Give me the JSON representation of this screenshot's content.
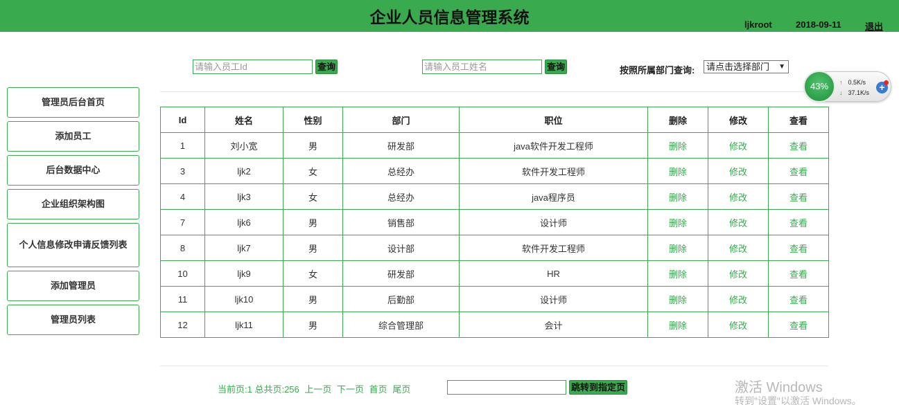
{
  "header": {
    "title": "企业人员信息管理系统",
    "username": "ljkroot",
    "date": "2018-09-11",
    "logout": "退出"
  },
  "sidebar": {
    "items": [
      {
        "label": "管理员后台首页"
      },
      {
        "label": "添加员工"
      },
      {
        "label": "后台数据中心"
      },
      {
        "label": "企业组织架构图"
      },
      {
        "label": "个人信息修改申请反馈列表"
      },
      {
        "label": "添加管理员"
      },
      {
        "label": "管理员列表"
      }
    ]
  },
  "search": {
    "id_placeholder": "请输入员工Id",
    "id_button": "查询",
    "name_placeholder": "请输入员工姓名",
    "name_button": "查询",
    "dept_label": "按照所属部门查询:",
    "dept_selected": "请点击选择部门"
  },
  "table": {
    "headers": [
      "Id",
      "姓名",
      "性别",
      "部门",
      "职位",
      "删除",
      "修改",
      "查看"
    ],
    "rows": [
      {
        "id": "1",
        "name": "刘小宽",
        "gender": "男",
        "dept": "研发部",
        "position": "java软件开发工程师",
        "delete": "删除",
        "edit": "修改",
        "view": "查看"
      },
      {
        "id": "3",
        "name": "ljk2",
        "gender": "女",
        "dept": "总经办",
        "position": "软件开发工程师",
        "delete": "删除",
        "edit": "修改",
        "view": "查看"
      },
      {
        "id": "4",
        "name": "ljk3",
        "gender": "女",
        "dept": "总经办",
        "position": "java程序员",
        "delete": "删除",
        "edit": "修改",
        "view": "查看"
      },
      {
        "id": "7",
        "name": "ljk6",
        "gender": "男",
        "dept": "销售部",
        "position": "设计师",
        "delete": "删除",
        "edit": "修改",
        "view": "查看"
      },
      {
        "id": "8",
        "name": "ljk7",
        "gender": "男",
        "dept": "设计部",
        "position": "软件开发工程师",
        "delete": "删除",
        "edit": "修改",
        "view": "查看"
      },
      {
        "id": "10",
        "name": "ljk9",
        "gender": "女",
        "dept": "研发部",
        "position": "HR",
        "delete": "删除",
        "edit": "修改",
        "view": "查看"
      },
      {
        "id": "11",
        "name": "ljk10",
        "gender": "男",
        "dept": "后勤部",
        "position": "设计师",
        "delete": "删除",
        "edit": "修改",
        "view": "查看"
      },
      {
        "id": "12",
        "name": "ljk11",
        "gender": "男",
        "dept": "综合管理部",
        "position": "会计",
        "delete": "删除",
        "edit": "修改",
        "view": "查看"
      }
    ]
  },
  "pager": {
    "status": "当前页:1 总共页:256",
    "prev": "上一页",
    "next": "下一页",
    "first": "首页",
    "last": "尾页",
    "jump_button": "跳转到指定页"
  },
  "speed_widget": {
    "percent": "43%",
    "up": "0.5K/s",
    "down": "37.1K/s"
  },
  "watermark": {
    "line1": "激活 Windows",
    "line2": "转到\"设置\"以激活 Windows。"
  },
  "colors": {
    "accent": "#3aaa4f"
  }
}
